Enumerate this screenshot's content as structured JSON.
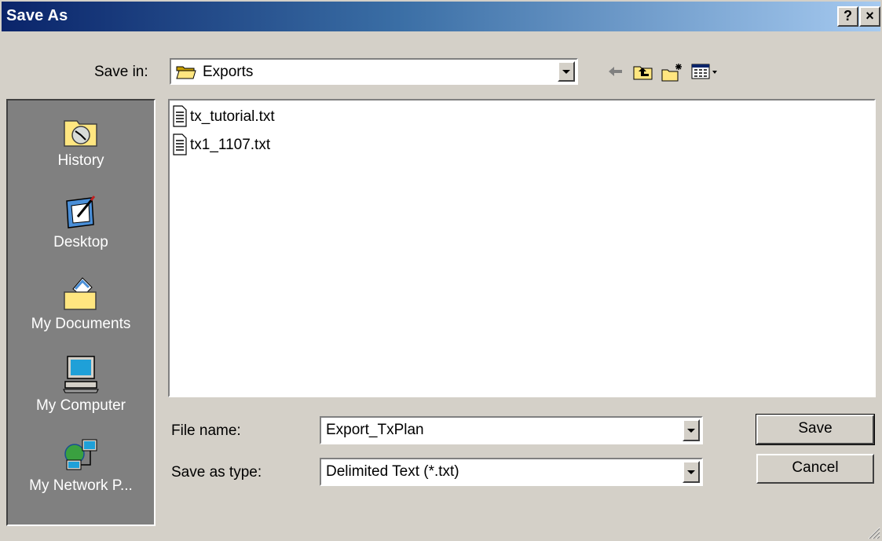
{
  "window": {
    "title": "Save As",
    "help_glyph": "?",
    "close_glyph": "×"
  },
  "save_in": {
    "label": "Save in:",
    "value": "Exports",
    "value_icon": "folder-open-icon"
  },
  "toolbar": {
    "items": [
      {
        "name": "back-icon"
      },
      {
        "name": "up-one-level-icon"
      },
      {
        "name": "create-new-folder-icon"
      },
      {
        "name": "view-menu-icon"
      }
    ]
  },
  "places": {
    "items": [
      {
        "label": "History",
        "icon": "history-icon"
      },
      {
        "label": "Desktop",
        "icon": "desktop-icon"
      },
      {
        "label": "My Documents",
        "icon": "my-documents-icon"
      },
      {
        "label": "My Computer",
        "icon": "my-computer-icon"
      },
      {
        "label": "My Network P...",
        "icon": "my-network-places-icon"
      }
    ]
  },
  "files": [
    {
      "name": "tx_tutorial.txt",
      "icon": "text-file-icon"
    },
    {
      "name": "tx1_1107.txt",
      "icon": "text-file-icon"
    }
  ],
  "file_name": {
    "label": "File name:",
    "value": "Export_TxPlan"
  },
  "save_as_type": {
    "label": "Save as type:",
    "value": "Delimited Text (*.txt)"
  },
  "buttons": {
    "save": "Save",
    "cancel": "Cancel"
  },
  "colors": {
    "title_start": "#0a246a",
    "title_end": "#a6caf0",
    "face": "#d4d0c8",
    "places_bg": "#808080"
  }
}
